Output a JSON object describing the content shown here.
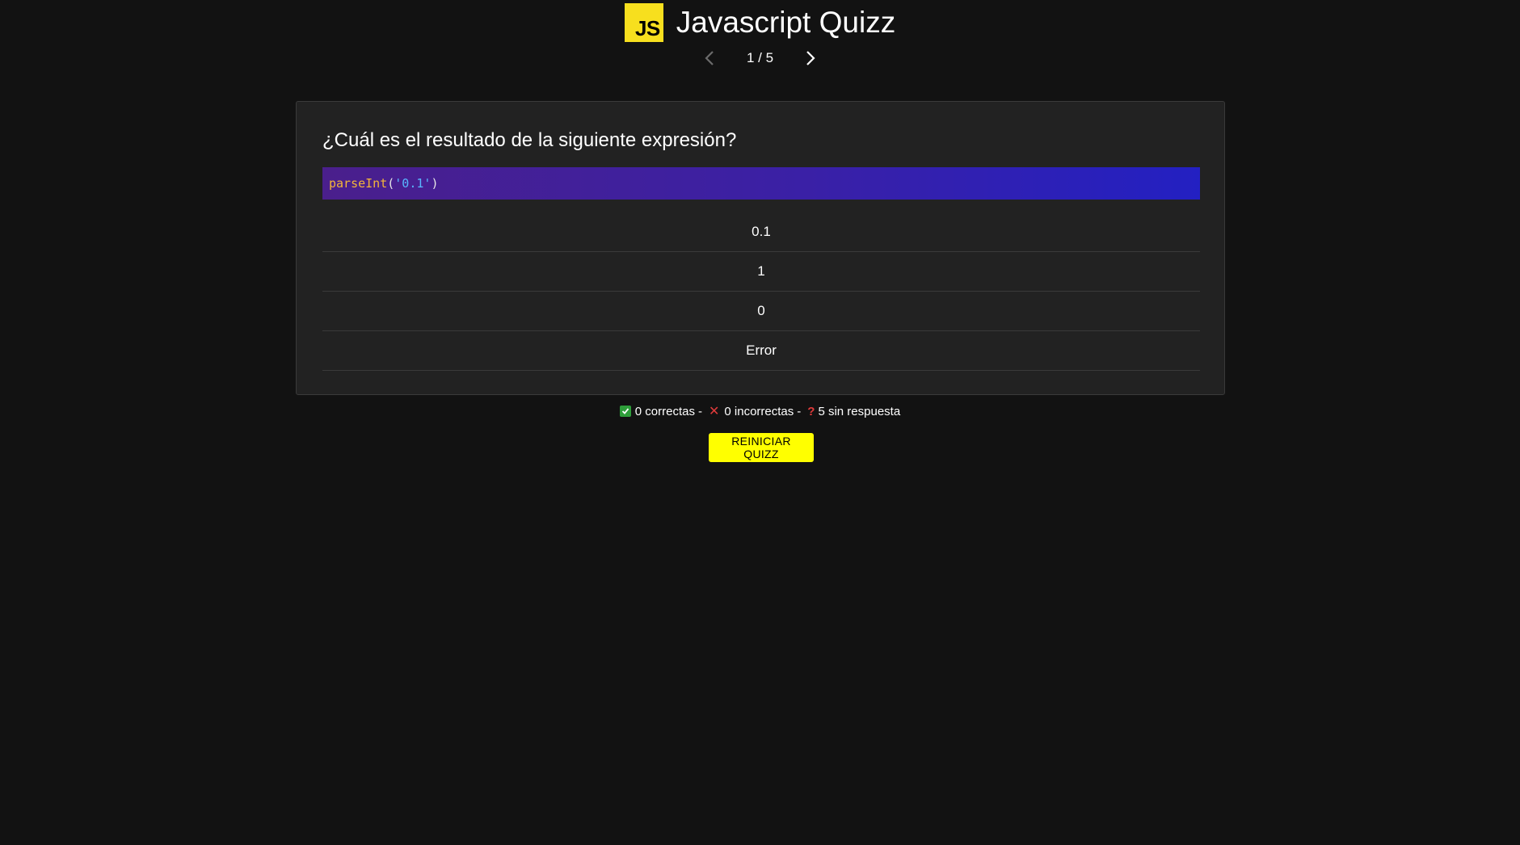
{
  "app": {
    "logo_text": "JS",
    "title": "Javascript Quizz"
  },
  "pager": {
    "current": "1",
    "separator": "/",
    "total": "5",
    "label": "1 / 5"
  },
  "question": {
    "text": "¿Cuál es el resultado de la siguiente expresión?",
    "code": {
      "fn": "parseInt",
      "open": "(",
      "arg": "'0.1'",
      "close": ")"
    },
    "options": [
      "0.1",
      "1",
      "0",
      "Error"
    ]
  },
  "stats": {
    "correct": "0 correctas",
    "incorrect": "0 incorrectas",
    "unanswered": "5 sin respuesta",
    "separator": "-"
  },
  "actions": {
    "restart_label": "REINICIAR QUIZZ"
  },
  "colors": {
    "background": "#121212",
    "card": "#222222",
    "brand": "#f7df1e",
    "restart_button": "#ffff00"
  },
  "icons": {
    "prev": "chevron-left-icon",
    "next": "chevron-right-icon",
    "correct": "check-icon",
    "incorrect": "x-icon",
    "unanswered": "question-icon"
  }
}
